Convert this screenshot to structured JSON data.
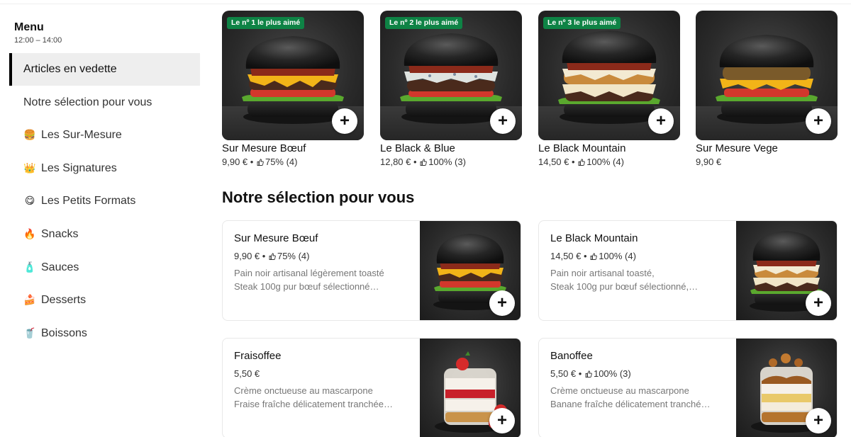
{
  "sidebar": {
    "title": "Menu",
    "hours": "12:00 – 14:00",
    "items": [
      {
        "label": "Articles en vedette",
        "emoji": ""
      },
      {
        "label": "Notre sélection pour vous",
        "emoji": ""
      },
      {
        "label": "Les Sur-Mesure",
        "emoji": "🍔"
      },
      {
        "label": "Les Signatures",
        "emoji": "👑"
      },
      {
        "label": "Les Petits Formats",
        "emoji": "😋"
      },
      {
        "label": "Snacks",
        "emoji": "🔥"
      },
      {
        "label": "Sauces",
        "emoji": "🧴"
      },
      {
        "label": "Desserts",
        "emoji": "🍰"
      },
      {
        "label": "Boissons",
        "emoji": "🥤"
      }
    ],
    "active_index": 0
  },
  "featured": [
    {
      "badge": "Le nº 1 le plus aimé",
      "name": "Sur Mesure Bœuf",
      "price": "9,90 €",
      "sep": "•",
      "rating": "75% (4)",
      "variant": "cheddar"
    },
    {
      "badge": "Le nº 2 le plus aimé",
      "name": "Le Black & Blue",
      "price": "12,80 €",
      "sep": "•",
      "rating": "100% (3)",
      "variant": "blue"
    },
    {
      "badge": "Le nº 3 le plus aimé",
      "name": "Le Black Mountain",
      "price": "14,50 €",
      "sep": "•",
      "rating": "100% (4)",
      "variant": "mountain"
    },
    {
      "badge": "",
      "name": "Sur Mesure Vege",
      "price": "9,90 €",
      "sep": "",
      "rating": "",
      "variant": "vege"
    }
  ],
  "selection": {
    "title": "Notre sélection pour vous",
    "items": [
      {
        "name": "Sur Mesure Bœuf",
        "price": "9,90 €",
        "sep": "•",
        "rating": "75% (4)",
        "desc1": "Pain noir artisanal légèrement toasté",
        "desc2": "Steak 100g pur bœuf sélectionné…"
      },
      {
        "name": "Le Black Mountain",
        "price": "14,50 €",
        "sep": "•",
        "rating": "100% (4)",
        "desc1": "Pain noir artisanal toasté,",
        "desc2": "Steak 100g pur bœuf sélectionné,…"
      },
      {
        "name": "Fraisoffee",
        "price": "5,50 €",
        "sep": "",
        "rating": "",
        "desc1": "Crème onctueuse au mascarpone",
        "desc2": "Fraise fraîche délicatement tranchée…"
      },
      {
        "name": "Banoffee",
        "price": "5,50 €",
        "sep": "•",
        "rating": "100% (3)",
        "desc1": "Crème onctueuse au mascarpone",
        "desc2": "Banane fraîche délicatement tranché…"
      }
    ]
  },
  "add_label": "+",
  "colors": {
    "badge": "#0e8345",
    "active_bg": "#eeeeee",
    "text": "#111111",
    "muted": "#777777"
  }
}
